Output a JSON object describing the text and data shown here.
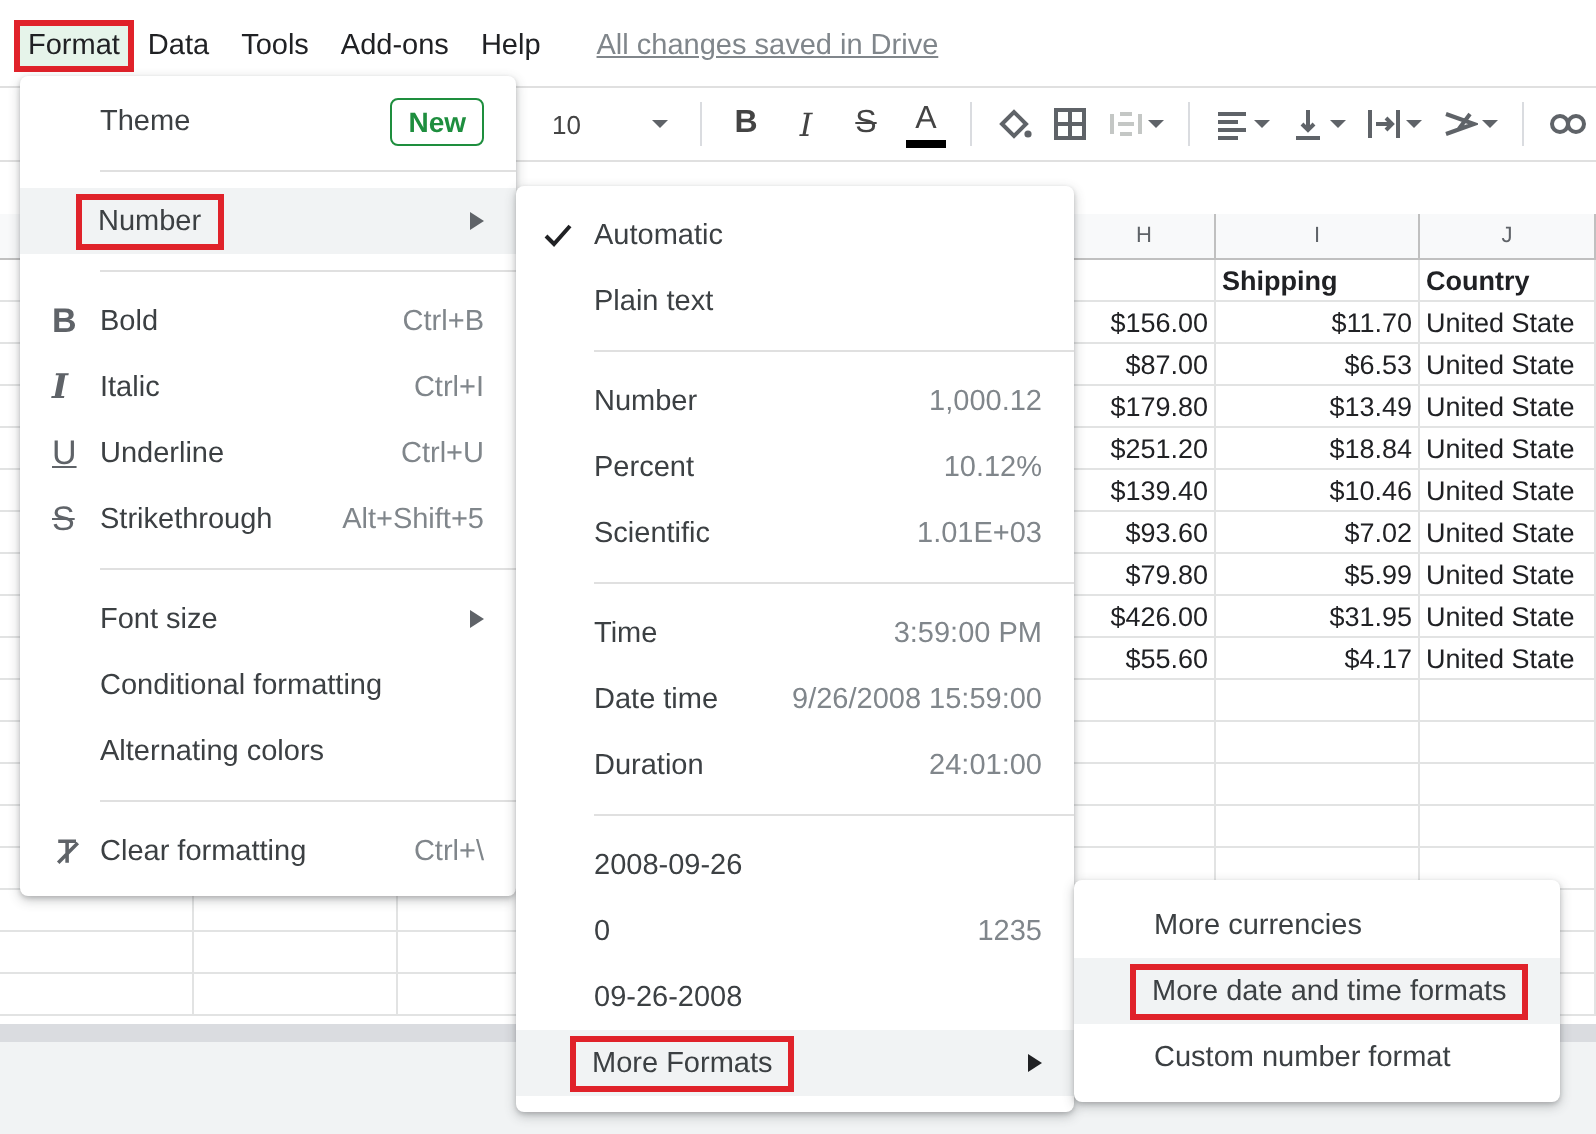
{
  "menu_bar": {
    "items": [
      {
        "label": "Format",
        "selected": true,
        "annotated": true
      },
      {
        "label": "Data",
        "selected": false,
        "annotated": false
      },
      {
        "label": "Tools",
        "selected": false,
        "annotated": false
      },
      {
        "label": "Add-ons",
        "selected": false,
        "annotated": false
      },
      {
        "label": "Help",
        "selected": false,
        "annotated": false
      }
    ],
    "save_status": "All changes saved in Drive"
  },
  "toolbar": {
    "font_size": "10",
    "text_buttons": [
      {
        "kind": "bold",
        "label": "B"
      },
      {
        "kind": "italic",
        "label": "I"
      },
      {
        "kind": "strike",
        "label": "S"
      },
      {
        "kind": "color",
        "label": "A"
      }
    ],
    "merge_cells": {
      "disabled": true
    }
  },
  "sheet": {
    "columns": [
      "H",
      "I",
      "J"
    ],
    "title_row": [
      "Shipping",
      "Country"
    ],
    "rows": [
      {
        "h": "$156.00",
        "i": "$11.70",
        "j": "United State"
      },
      {
        "h": "$87.00",
        "i": "$6.53",
        "j": "United State"
      },
      {
        "h": "$179.80",
        "i": "$13.49",
        "j": "United State"
      },
      {
        "h": "$251.20",
        "i": "$18.84",
        "j": "United State"
      },
      {
        "h": "$139.40",
        "i": "$10.46",
        "j": "United State"
      },
      {
        "h": "$93.60",
        "i": "$7.02",
        "j": "United State"
      },
      {
        "h": "$79.80",
        "i": "$5.99",
        "j": "United State"
      },
      {
        "h": "$426.00",
        "i": "$31.95",
        "j": "United State"
      },
      {
        "h": "$55.60",
        "i": "$4.17",
        "j": "United State"
      }
    ]
  },
  "format_menu": {
    "items": [
      {
        "kind": "plain",
        "label": "Theme",
        "badge": "New",
        "submenu": false,
        "selected": false,
        "annotated": false
      },
      {
        "kind": "divider"
      },
      {
        "kind": "plain",
        "label": "Number",
        "submenu": true,
        "selected": true,
        "annotated": true
      },
      {
        "kind": "divider"
      },
      {
        "kind": "bold",
        "glyph": "B",
        "label": "Bold",
        "shortcut": "Ctrl+B",
        "submenu": false,
        "selected": false,
        "annotated": false
      },
      {
        "kind": "italic",
        "glyph": "I",
        "label": "Italic",
        "shortcut": "Ctrl+I",
        "submenu": false,
        "selected": false,
        "annotated": false
      },
      {
        "kind": "underline",
        "glyph": "U",
        "label": "Underline",
        "shortcut": "Ctrl+U",
        "submenu": false,
        "selected": false,
        "annotated": false
      },
      {
        "kind": "strike",
        "glyph": "S",
        "label": "Strikethrough",
        "shortcut": "Alt+Shift+5",
        "submenu": false,
        "selected": false,
        "annotated": false
      },
      {
        "kind": "divider"
      },
      {
        "kind": "plain",
        "label": "Font size",
        "submenu": true,
        "selected": false,
        "annotated": false
      },
      {
        "kind": "plain",
        "label": "Conditional formatting",
        "submenu": false,
        "selected": false,
        "annotated": false
      },
      {
        "kind": "plain",
        "label": "Alternating colors",
        "submenu": false,
        "selected": false,
        "annotated": false
      },
      {
        "kind": "divider"
      },
      {
        "kind": "clear",
        "label": "Clear formatting",
        "shortcut": "Ctrl+\\",
        "submenu": false,
        "selected": false,
        "annotated": false
      }
    ]
  },
  "number_menu": {
    "items": [
      {
        "kind": "plain",
        "label": "Automatic",
        "checked": true,
        "submenu": false,
        "selected": false,
        "annotated": false
      },
      {
        "kind": "plain",
        "label": "Plain text",
        "checked": false,
        "submenu": false,
        "selected": false,
        "annotated": false
      },
      {
        "kind": "divider"
      },
      {
        "kind": "plain",
        "label": "Number",
        "value": "1,000.12",
        "checked": false,
        "submenu": false,
        "selected": false,
        "annotated": false
      },
      {
        "kind": "plain",
        "label": "Percent",
        "value": "10.12%",
        "checked": false,
        "submenu": false,
        "selected": false,
        "annotated": false
      },
      {
        "kind": "plain",
        "label": "Scientific",
        "value": "1.01E+03",
        "checked": false,
        "submenu": false,
        "selected": false,
        "annotated": false
      },
      {
        "kind": "divider"
      },
      {
        "kind": "plain",
        "label": "Time",
        "value": "3:59:00 PM",
        "checked": false,
        "submenu": false,
        "selected": false,
        "annotated": false
      },
      {
        "kind": "plain",
        "label": "Date time",
        "value": "9/26/2008 15:59:00",
        "checked": false,
        "submenu": false,
        "selected": false,
        "annotated": false
      },
      {
        "kind": "plain",
        "label": "Duration",
        "value": "24:01:00",
        "checked": false,
        "submenu": false,
        "selected": false,
        "annotated": false
      },
      {
        "kind": "divider"
      },
      {
        "kind": "plain",
        "label": "2008-09-26",
        "checked": false,
        "submenu": false,
        "selected": false,
        "annotated": false
      },
      {
        "kind": "plain",
        "label": "0",
        "value": "1235",
        "checked": false,
        "submenu": false,
        "selected": false,
        "annotated": false
      },
      {
        "kind": "plain",
        "label": "09-26-2008",
        "checked": false,
        "submenu": false,
        "selected": false,
        "annotated": false
      },
      {
        "kind": "plain",
        "label": "More Formats",
        "checked": false,
        "submenu": true,
        "selected": true,
        "annotated": true
      }
    ]
  },
  "more_formats_menu": {
    "items": [
      {
        "label": "More currencies",
        "submenu": false,
        "selected": false,
        "annotated": false
      },
      {
        "label": "More date and time formats",
        "submenu": false,
        "selected": true,
        "annotated": true
      },
      {
        "label": "Custom number format",
        "submenu": false,
        "selected": false,
        "annotated": false
      }
    ]
  }
}
